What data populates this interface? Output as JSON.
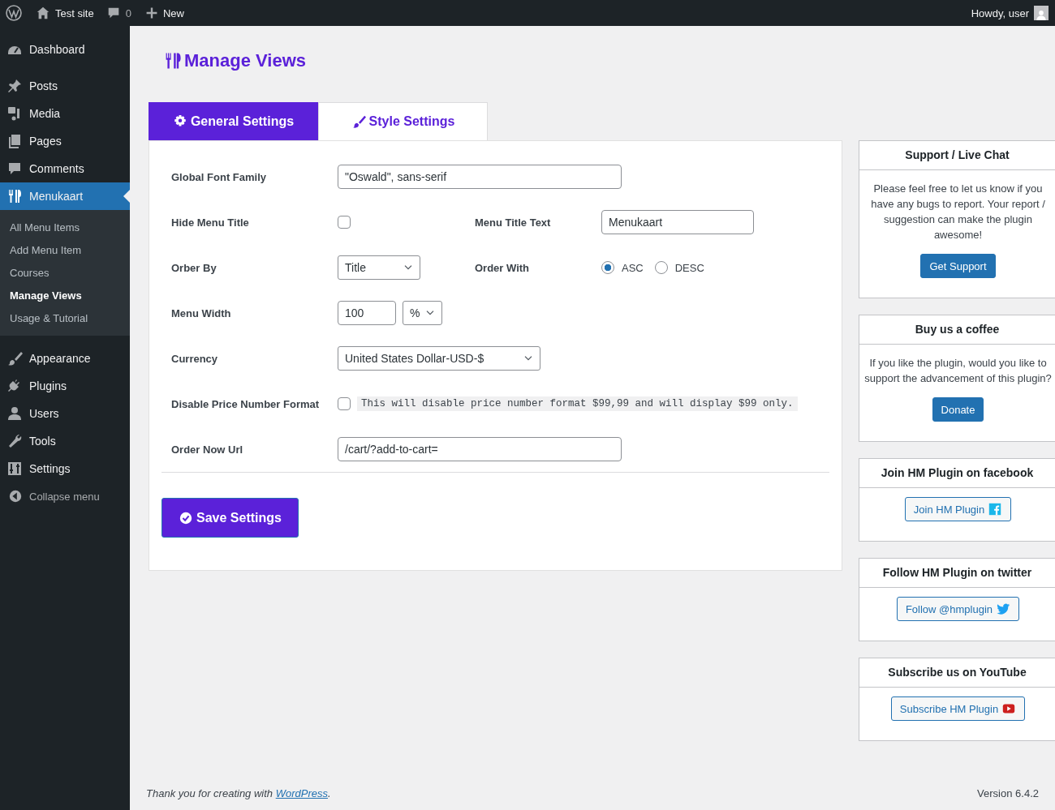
{
  "admin_bar": {
    "site": "Test site",
    "comments": "0",
    "new": "New",
    "greeting": "Howdy, user"
  },
  "sidebar": {
    "items": [
      {
        "label": "Dashboard",
        "selected": false
      },
      {
        "label": "Posts",
        "selected": false
      },
      {
        "label": "Media",
        "selected": false
      },
      {
        "label": "Pages",
        "selected": false
      },
      {
        "label": "Comments",
        "selected": false
      },
      {
        "label": "Menukaart",
        "selected": true,
        "submenu": [
          {
            "label": "All Menu Items",
            "selected": false
          },
          {
            "label": "Add Menu Item",
            "selected": false
          },
          {
            "label": "Courses",
            "selected": false
          },
          {
            "label": "Manage Views",
            "selected": true
          },
          {
            "label": "Usage & Tutorial",
            "selected": false
          }
        ]
      },
      {
        "label": "Appearance",
        "selected": false
      },
      {
        "label": "Plugins",
        "selected": false
      },
      {
        "label": "Users",
        "selected": false
      },
      {
        "label": "Tools",
        "selected": false
      },
      {
        "label": "Settings",
        "selected": false
      }
    ],
    "collapse": "Collapse menu"
  },
  "page": {
    "title": "Manage Views"
  },
  "tabs": [
    {
      "label": "General Settings",
      "selected": true
    },
    {
      "label": "Style Settings",
      "selected": false
    }
  ],
  "form": {
    "rows": [
      {
        "label": "Global Font Family",
        "controls": [
          {
            "kind": "text",
            "value": "\"Oswald\", sans-serif"
          }
        ]
      },
      {
        "label": "Hide Menu Title",
        "controls": [
          {
            "kind": "checkbox",
            "checked": false
          }
        ],
        "second": {
          "label": "Menu Title Text",
          "controls": [
            {
              "kind": "text",
              "value": "Menukaart"
            }
          ]
        }
      },
      {
        "label": "Orber By",
        "controls": [
          {
            "kind": "select",
            "value": "Title"
          }
        ],
        "second": {
          "label": "Order With",
          "controls": [
            {
              "kind": "radio",
              "label": "ASC",
              "selected": true
            },
            {
              "kind": "radio",
              "label": "DESC",
              "selected": false
            }
          ]
        }
      },
      {
        "label": "Menu Width",
        "controls": [
          {
            "kind": "text",
            "value": "100"
          },
          {
            "kind": "select",
            "value": "%"
          }
        ]
      },
      {
        "label": "Currency",
        "controls": [
          {
            "kind": "select",
            "value": "United States Dollar-USD-$"
          }
        ]
      },
      {
        "label": "Disable Price Number Format",
        "controls": [
          {
            "kind": "checkbox",
            "checked": false
          },
          {
            "kind": "note",
            "text": "This will disable price number format $99,99 and will display $99 only."
          }
        ]
      },
      {
        "label": "Order Now Url",
        "controls": [
          {
            "kind": "text",
            "value": "/cart/?add-to-cart="
          }
        ]
      }
    ],
    "save_button": "Save Settings"
  },
  "widgets": [
    {
      "title": "Support / Live Chat",
      "text": "Please feel free to let us know if you have any bugs to report. Your report / suggestion can make the plugin awesome!",
      "button": "Get Support",
      "kind": "primary"
    },
    {
      "title": "Buy us a coffee",
      "text": "If you like the plugin, would you like to support the advancement of this plugin?",
      "button": "Donate",
      "kind": "primary"
    },
    {
      "title": "Join HM Plugin on facebook",
      "button": "Join HM Plugin",
      "kind": "facebook"
    },
    {
      "title": "Follow HM Plugin on twitter",
      "button": "Follow @hmplugin",
      "kind": "twitter"
    },
    {
      "title": "Subscribe us on YouTube",
      "button": "Subscribe HM Plugin",
      "kind": "youtube"
    }
  ],
  "footer": {
    "thanks": "Thank you for creating with ",
    "link": "WordPress",
    "thanks_end": ".",
    "version": "Version 6.4.2"
  }
}
